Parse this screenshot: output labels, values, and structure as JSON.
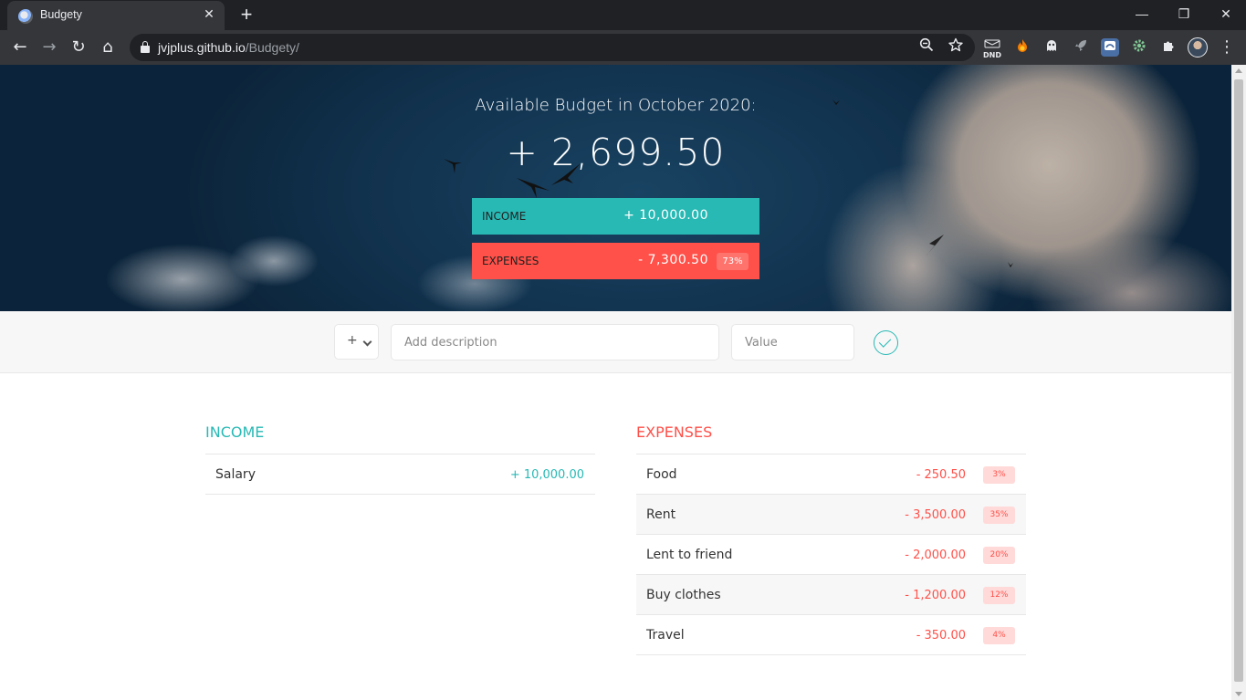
{
  "browser": {
    "tab_title": "Budgety",
    "tab_close": "✕",
    "new_tab": "+",
    "window": {
      "minimize": "—",
      "restore": "❐",
      "close": "✕"
    },
    "url_host": "jvjplus.github.io",
    "url_path": "/Budgety/",
    "nav": {
      "back": "←",
      "forward": "→",
      "reload": "↻",
      "home": "⌂"
    },
    "extensions": [
      {
        "name": "dnd",
        "label": "DND",
        "color": "#202124"
      },
      {
        "name": "fire",
        "label": "🔥",
        "color": "#35363a"
      },
      {
        "name": "ghost",
        "label": "👻",
        "color": "#35363a"
      },
      {
        "name": "rocket",
        "label": "🚀",
        "color": "#35363a"
      },
      {
        "name": "shield",
        "label": "◆",
        "color": "#4a6fa5"
      },
      {
        "name": "gear",
        "label": "⚙",
        "color": "#35363a"
      },
      {
        "name": "puzzle",
        "label": "✚",
        "color": "#35363a"
      }
    ],
    "menu": "⋮"
  },
  "hero": {
    "title": "Available Budget in October 2020:",
    "budget": "+ 2,699.50",
    "income": {
      "label": "INCOME",
      "value": "+ 10,000.00"
    },
    "expenses": {
      "label": "EXPENSES",
      "value": "- 7,300.50",
      "percent": "73%"
    }
  },
  "form": {
    "type": "+",
    "description_placeholder": "Add description",
    "value_placeholder": "Value"
  },
  "income": {
    "title": "INCOME",
    "items": [
      {
        "description": "Salary",
        "value": "+ 10,000.00"
      }
    ]
  },
  "expenses": {
    "title": "EXPENSES",
    "items": [
      {
        "description": "Food",
        "value": "- 250.50",
        "percent": "3%"
      },
      {
        "description": "Rent",
        "value": "- 3,500.00",
        "percent": "35%"
      },
      {
        "description": "Lent to friend",
        "value": "- 2,000.00",
        "percent": "20%"
      },
      {
        "description": "Buy clothes",
        "value": "- 1,200.00",
        "percent": "12%"
      },
      {
        "description": "Travel",
        "value": "- 350.00",
        "percent": "4%"
      }
    ]
  },
  "colors": {
    "income": "#28B9B5",
    "expenses": "#FF5049"
  }
}
